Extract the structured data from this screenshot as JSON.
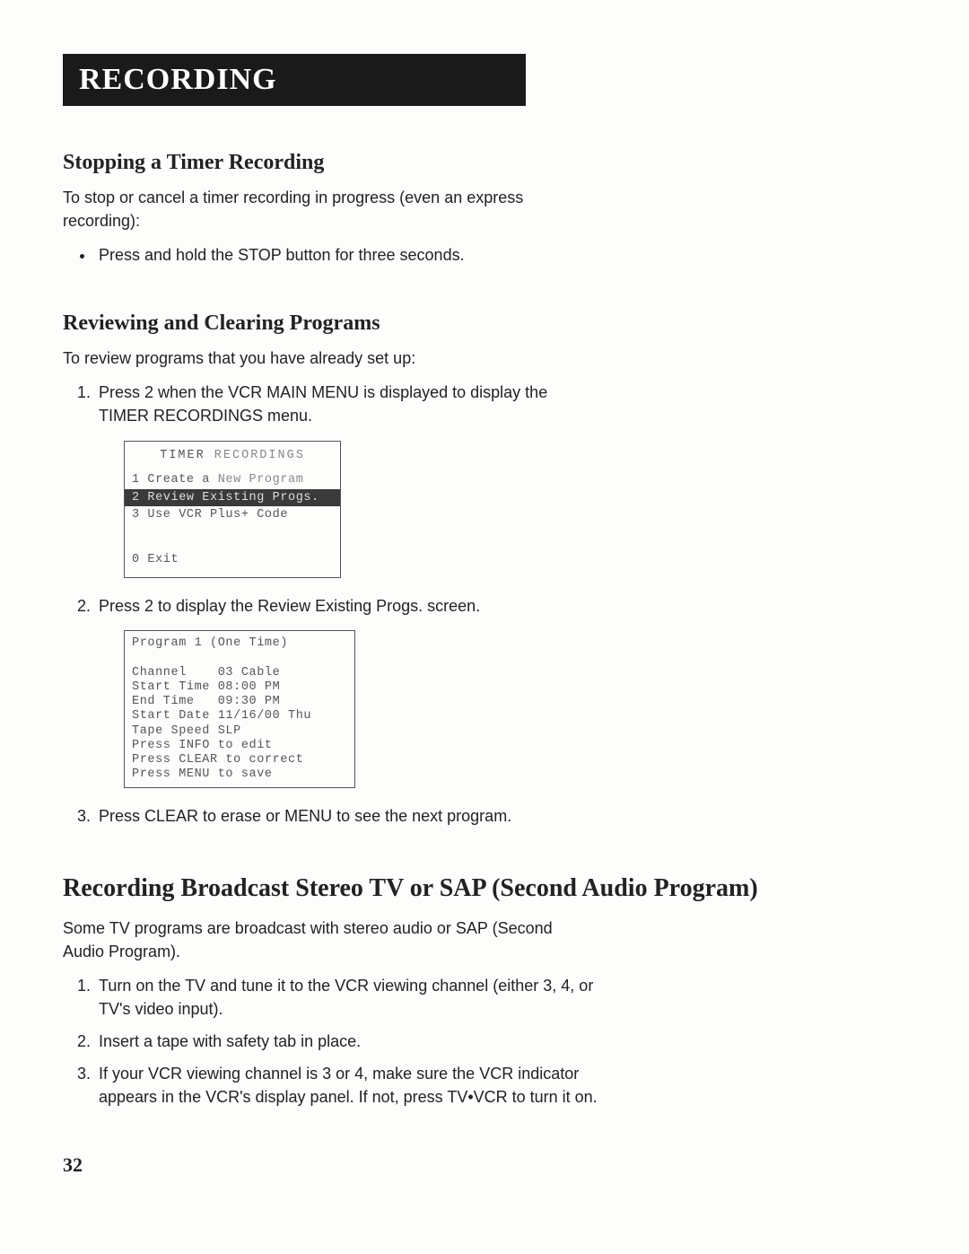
{
  "title_bar": "RECORDING",
  "section1": {
    "heading": "Stopping a Timer Recording",
    "intro": "To stop or cancel a timer recording in progress (even an express recording):",
    "bullet1": "Press and hold the STOP button for three seconds."
  },
  "section2": {
    "heading": "Reviewing and Clearing Programs",
    "intro": "To review programs that you have already set up:",
    "step1": "Press 2 when the VCR MAIN MENU is displayed to display the TIMER RECORDINGS menu.",
    "osd1": {
      "title_a": "TIMER",
      "title_b": " RECORDINGS",
      "row1a": "1 Create a",
      "row1b": " New Program",
      "row2": "2 Review Existing Progs.",
      "row3": "3 Use VCR Plus+ Code",
      "row4": "0 Exit"
    },
    "step2": "Press 2 to display the Review Existing Progs. screen.",
    "osd2": "Program 1 (One Time)\n\nChannel    03 Cable\nStart Time 08:00 PM\nEnd Time   09:30 PM\nStart Date 11/16/00 Thu\nTape Speed SLP\nPress INFO to edit\nPress CLEAR to correct\nPress MENU to save",
    "step3": "Press CLEAR to erase or MENU to see the next program."
  },
  "section3": {
    "heading": "Recording Broadcast Stereo TV or SAP (Second Audio Program)",
    "intro": "Some TV programs are broadcast with stereo audio or SAP (Second Audio Program).",
    "step1": "Turn on the TV and tune it to the VCR viewing channel (either 3, 4, or TV's video input).",
    "step2": "Insert a tape with safety tab in place.",
    "step3": "If your VCR viewing channel is 3 or 4, make sure the VCR indicator appears in the VCR's display panel. If not, press TV•VCR to turn it on."
  },
  "page_number": "32"
}
